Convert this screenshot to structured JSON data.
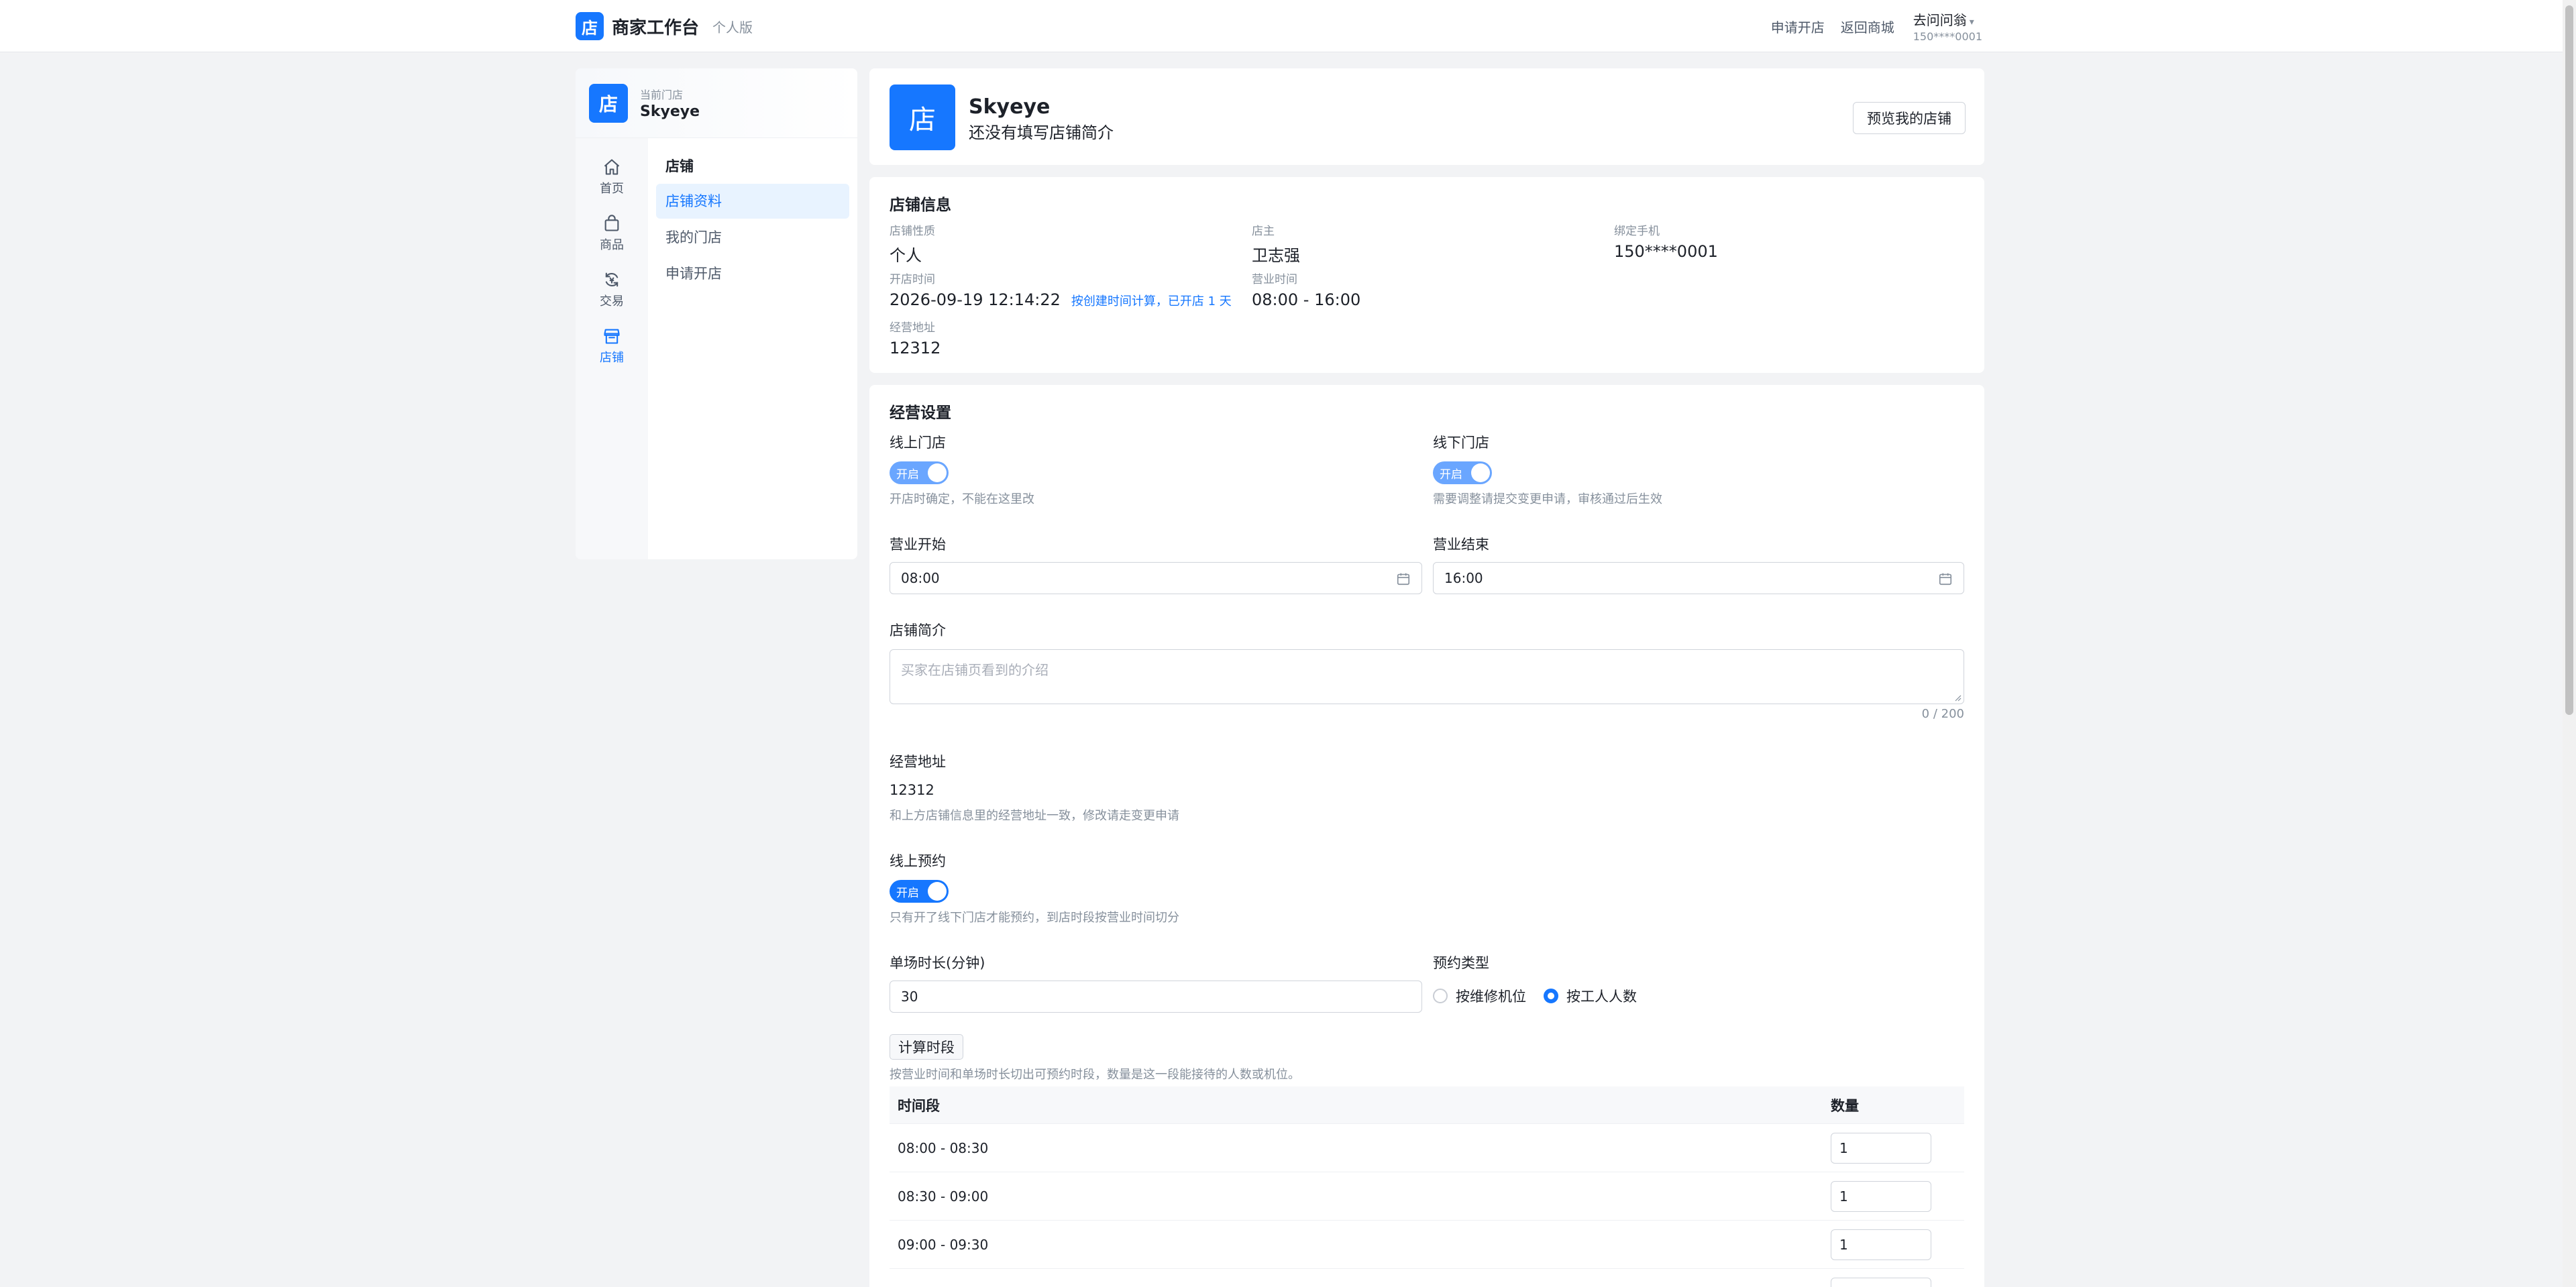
{
  "header": {
    "logo_char": "店",
    "title": "商家工作台",
    "edition": "个人版",
    "links": {
      "apply_store": "申请开店",
      "back_mall": "返回商城"
    },
    "user_name": "去问问翁",
    "user_phone": "150****0001"
  },
  "sidebar": {
    "store_avatar": "店",
    "store_label": "当前门店",
    "store_name": "Skyeye",
    "rail": [
      {
        "label": "首页",
        "icon": "home-icon"
      },
      {
        "label": "商品",
        "icon": "bag-icon"
      },
      {
        "label": "交易",
        "icon": "exchange-icon"
      },
      {
        "label": "店铺",
        "icon": "store-icon",
        "active": true
      }
    ],
    "submenu_title": "店铺",
    "submenu": [
      {
        "label": "店铺资料",
        "active": true
      },
      {
        "label": "我的门店"
      },
      {
        "label": "申请开店"
      }
    ]
  },
  "profile": {
    "avatar": "店",
    "name": "Skyeye",
    "intro": "还没有填写店铺简介",
    "preview_button": "预览我的店铺"
  },
  "store_info": {
    "title": "店铺信息",
    "nature_label": "店铺性质",
    "nature": "个人",
    "owner_label": "店主",
    "owner": "卫志强",
    "phone_label": "绑定手机",
    "phone": "150****0001",
    "open_time_label": "开店时间",
    "open_time": "2026-09-19 12:14:22",
    "open_time_hint": "按创建时间计算，已开店 1 天",
    "business_hours_label": "营业时间",
    "business_hours": "08:00 - 16:00",
    "address_label": "经营地址",
    "address": "12312"
  },
  "settings": {
    "title": "经营设置",
    "online_store_label": "线上门店",
    "online_store_switch": "开启",
    "online_store_help": "开店时确定，不能在这里改",
    "offline_store_label": "线下门店",
    "offline_store_switch": "开启",
    "offline_store_help": "需要调整请提交变更申请，审核通过后生效",
    "open_label": "营业开始",
    "open_value": "08:00",
    "close_label": "营业结束",
    "close_value": "16:00",
    "intro_label": "店铺简介",
    "intro_placeholder": "买家在店铺页看到的介绍",
    "intro_counter": "0 / 200",
    "address_label": "经营地址",
    "address_value": "12312",
    "address_help": "和上方店铺信息里的经营地址一致，修改请走变更申请",
    "booking_label": "线上预约",
    "booking_switch": "开启",
    "booking_help": "只有开了线下门店才能预约，到店时段按营业时间切分",
    "duration_label": "单场时长(分钟)",
    "duration_value": "30",
    "booking_type_label": "预约类型",
    "booking_type_options": [
      "按维修机位",
      "按工人人数"
    ],
    "booking_type_selected": "按工人人数",
    "calc_button": "计算时段",
    "calc_help": "按营业时间和单场时长切出可预约时段，数量是这一段能接待的人数或机位。",
    "table": {
      "col_time": "时间段",
      "col_qty": "数量",
      "rows": [
        {
          "time": "08:00 - 08:30",
          "qty": "1"
        },
        {
          "time": "08:30 - 09:00",
          "qty": "1"
        },
        {
          "time": "09:00 - 09:30",
          "qty": "1"
        },
        {
          "time": "",
          "qty": ""
        }
      ]
    }
  },
  "colors": {
    "primary": "#1677ff",
    "switch_dim": "#6aa6ff",
    "bg": "#f2f3f5"
  }
}
